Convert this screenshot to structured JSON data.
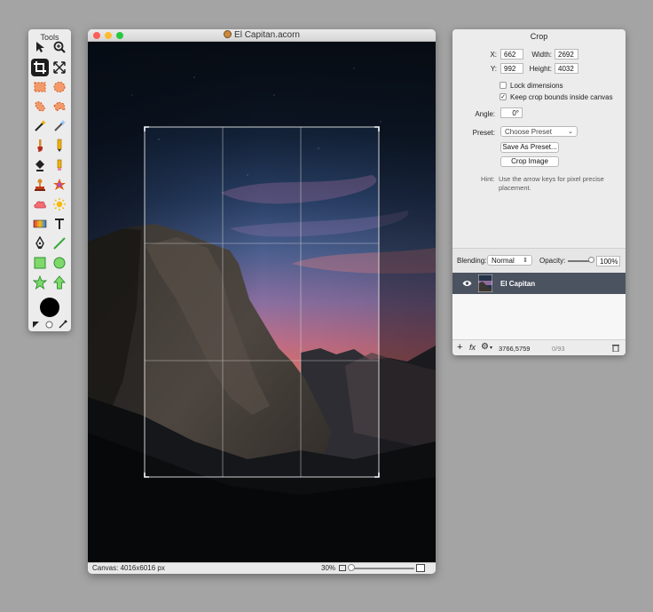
{
  "tools_panel": {
    "title": "Tools",
    "tools": [
      {
        "name": "move-tool-icon"
      },
      {
        "name": "zoom-tool-icon"
      },
      {
        "name": "crop-tool-icon",
        "active": true
      },
      {
        "name": "transform-tool-icon"
      },
      {
        "name": "rect-select-icon"
      },
      {
        "name": "ellipse-select-icon"
      },
      {
        "name": "lasso-icon"
      },
      {
        "name": "polygon-lasso-icon"
      },
      {
        "name": "magic-wand-icon"
      },
      {
        "name": "instant-alpha-icon"
      },
      {
        "name": "brush-icon"
      },
      {
        "name": "pencil-icon"
      },
      {
        "name": "paint-bucket-icon"
      },
      {
        "name": "eraser-icon"
      },
      {
        "name": "clone-stamp-icon"
      },
      {
        "name": "smudge-icon"
      },
      {
        "name": "cloud-icon"
      },
      {
        "name": "sun-icon"
      },
      {
        "name": "gradient-icon"
      },
      {
        "name": "text-tool-icon"
      },
      {
        "name": "pen-tool-icon"
      },
      {
        "name": "line-tool-icon"
      },
      {
        "name": "rectangle-shape-icon"
      },
      {
        "name": "oval-shape-icon"
      },
      {
        "name": "star-shape-icon"
      },
      {
        "name": "arrow-shape-icon"
      }
    ],
    "foreground_color": "#000000"
  },
  "document": {
    "title": "El Capitan.acorn",
    "status_canvas": "Canvas: 4016x6016 px",
    "zoom": "30%",
    "zoom_fraction": 0.0
  },
  "crop_panel": {
    "title": "Crop",
    "x_label": "X:",
    "x_value": "662",
    "y_label": "Y:",
    "y_value": "992",
    "width_label": "Width:",
    "width_value": "2692",
    "height_label": "Height:",
    "height_value": "4032",
    "lock_label": "Lock dimensions",
    "lock_checked": false,
    "keep_label": "Keep crop bounds inside canvas",
    "keep_checked": true,
    "angle_label": "Angle:",
    "angle_value": "0°",
    "preset_label": "Preset:",
    "preset_value": "Choose Preset",
    "save_preset_label": "Save As Preset...",
    "crop_image_label": "Crop Image",
    "hint_label": "Hint:",
    "hint_text": "Use the arrow keys for pixel precise placement.",
    "blending_label": "Blending:",
    "blending_value": "Normal",
    "opacity_label": "Opacity:",
    "opacity_value": "100%",
    "layer_name": "El Capitan",
    "footer_coords": "3766,5759",
    "footer_count": "0/93"
  }
}
